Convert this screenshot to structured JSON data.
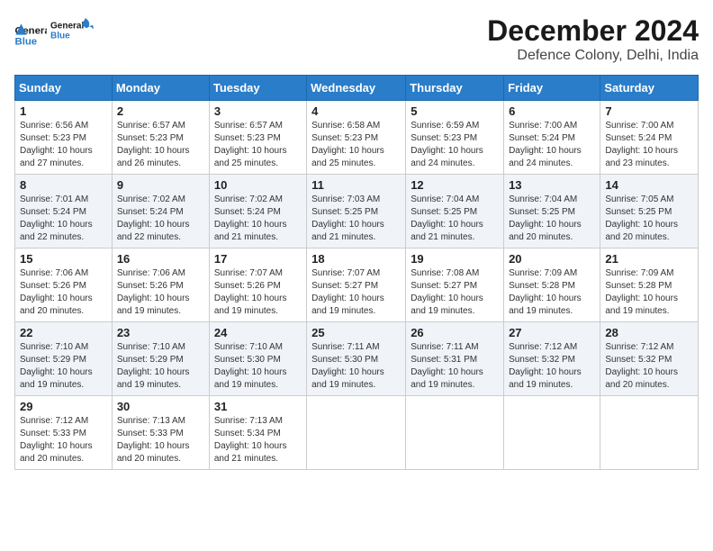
{
  "logo": {
    "text1": "General",
    "text2": "Blue"
  },
  "title": "December 2024",
  "location": "Defence Colony, Delhi, India",
  "days_of_week": [
    "Sunday",
    "Monday",
    "Tuesday",
    "Wednesday",
    "Thursday",
    "Friday",
    "Saturday"
  ],
  "weeks": [
    [
      {
        "day": "1",
        "sunrise": "6:56 AM",
        "sunset": "5:23 PM",
        "daylight": "10 hours and 27 minutes."
      },
      {
        "day": "2",
        "sunrise": "6:57 AM",
        "sunset": "5:23 PM",
        "daylight": "10 hours and 26 minutes."
      },
      {
        "day": "3",
        "sunrise": "6:57 AM",
        "sunset": "5:23 PM",
        "daylight": "10 hours and 25 minutes."
      },
      {
        "day": "4",
        "sunrise": "6:58 AM",
        "sunset": "5:23 PM",
        "daylight": "10 hours and 25 minutes."
      },
      {
        "day": "5",
        "sunrise": "6:59 AM",
        "sunset": "5:23 PM",
        "daylight": "10 hours and 24 minutes."
      },
      {
        "day": "6",
        "sunrise": "7:00 AM",
        "sunset": "5:24 PM",
        "daylight": "10 hours and 24 minutes."
      },
      {
        "day": "7",
        "sunrise": "7:00 AM",
        "sunset": "5:24 PM",
        "daylight": "10 hours and 23 minutes."
      }
    ],
    [
      {
        "day": "8",
        "sunrise": "7:01 AM",
        "sunset": "5:24 PM",
        "daylight": "10 hours and 22 minutes."
      },
      {
        "day": "9",
        "sunrise": "7:02 AM",
        "sunset": "5:24 PM",
        "daylight": "10 hours and 22 minutes."
      },
      {
        "day": "10",
        "sunrise": "7:02 AM",
        "sunset": "5:24 PM",
        "daylight": "10 hours and 21 minutes."
      },
      {
        "day": "11",
        "sunrise": "7:03 AM",
        "sunset": "5:25 PM",
        "daylight": "10 hours and 21 minutes."
      },
      {
        "day": "12",
        "sunrise": "7:04 AM",
        "sunset": "5:25 PM",
        "daylight": "10 hours and 21 minutes."
      },
      {
        "day": "13",
        "sunrise": "7:04 AM",
        "sunset": "5:25 PM",
        "daylight": "10 hours and 20 minutes."
      },
      {
        "day": "14",
        "sunrise": "7:05 AM",
        "sunset": "5:25 PM",
        "daylight": "10 hours and 20 minutes."
      }
    ],
    [
      {
        "day": "15",
        "sunrise": "7:06 AM",
        "sunset": "5:26 PM",
        "daylight": "10 hours and 20 minutes."
      },
      {
        "day": "16",
        "sunrise": "7:06 AM",
        "sunset": "5:26 PM",
        "daylight": "10 hours and 19 minutes."
      },
      {
        "day": "17",
        "sunrise": "7:07 AM",
        "sunset": "5:26 PM",
        "daylight": "10 hours and 19 minutes."
      },
      {
        "day": "18",
        "sunrise": "7:07 AM",
        "sunset": "5:27 PM",
        "daylight": "10 hours and 19 minutes."
      },
      {
        "day": "19",
        "sunrise": "7:08 AM",
        "sunset": "5:27 PM",
        "daylight": "10 hours and 19 minutes."
      },
      {
        "day": "20",
        "sunrise": "7:09 AM",
        "sunset": "5:28 PM",
        "daylight": "10 hours and 19 minutes."
      },
      {
        "day": "21",
        "sunrise": "7:09 AM",
        "sunset": "5:28 PM",
        "daylight": "10 hours and 19 minutes."
      }
    ],
    [
      {
        "day": "22",
        "sunrise": "7:10 AM",
        "sunset": "5:29 PM",
        "daylight": "10 hours and 19 minutes."
      },
      {
        "day": "23",
        "sunrise": "7:10 AM",
        "sunset": "5:29 PM",
        "daylight": "10 hours and 19 minutes."
      },
      {
        "day": "24",
        "sunrise": "7:10 AM",
        "sunset": "5:30 PM",
        "daylight": "10 hours and 19 minutes."
      },
      {
        "day": "25",
        "sunrise": "7:11 AM",
        "sunset": "5:30 PM",
        "daylight": "10 hours and 19 minutes."
      },
      {
        "day": "26",
        "sunrise": "7:11 AM",
        "sunset": "5:31 PM",
        "daylight": "10 hours and 19 minutes."
      },
      {
        "day": "27",
        "sunrise": "7:12 AM",
        "sunset": "5:32 PM",
        "daylight": "10 hours and 19 minutes."
      },
      {
        "day": "28",
        "sunrise": "7:12 AM",
        "sunset": "5:32 PM",
        "daylight": "10 hours and 20 minutes."
      }
    ],
    [
      {
        "day": "29",
        "sunrise": "7:12 AM",
        "sunset": "5:33 PM",
        "daylight": "10 hours and 20 minutes."
      },
      {
        "day": "30",
        "sunrise": "7:13 AM",
        "sunset": "5:33 PM",
        "daylight": "10 hours and 20 minutes."
      },
      {
        "day": "31",
        "sunrise": "7:13 AM",
        "sunset": "5:34 PM",
        "daylight": "10 hours and 21 minutes."
      },
      null,
      null,
      null,
      null
    ]
  ],
  "labels": {
    "sunrise": "Sunrise:",
    "sunset": "Sunset:",
    "daylight": "Daylight:"
  }
}
